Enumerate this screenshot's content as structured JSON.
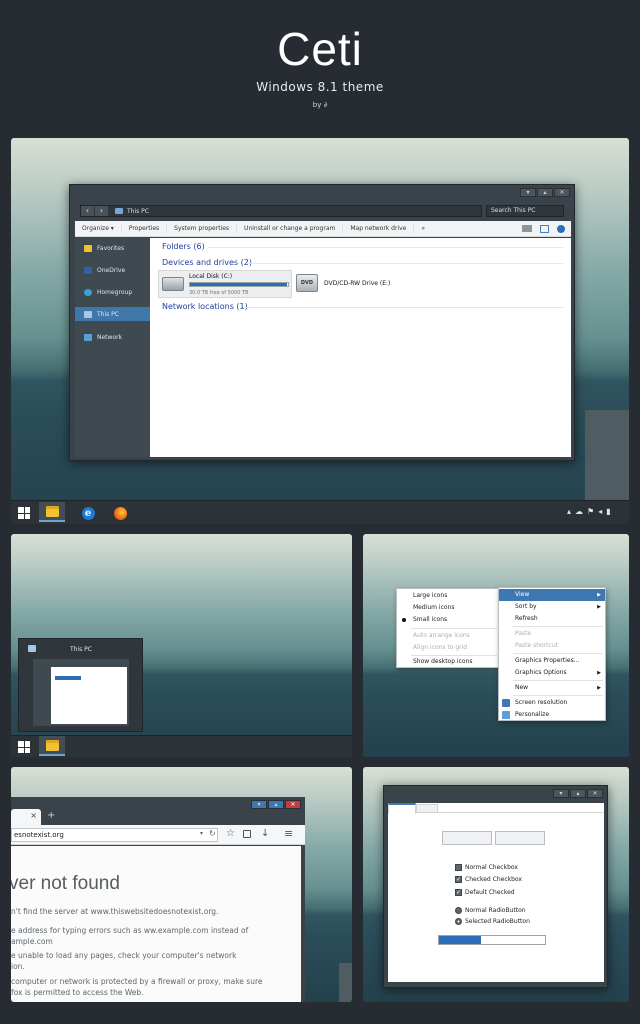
{
  "header": {
    "title": "Ceti",
    "subtitle": "Windows 8.1 theme",
    "byline": "by ∂"
  },
  "explorer": {
    "address": "This PC",
    "search_placeholder": "Search This PC",
    "ribbon": [
      "Organize ▾",
      "Properties",
      "System properties",
      "Uninstall or change a program",
      "Map network drive",
      "»"
    ],
    "nav": [
      "Favorites",
      "OneDrive",
      "Homegroup",
      "This PC",
      "Network"
    ],
    "selected_nav": "This PC",
    "groups": {
      "folders": "Folders (6)",
      "devices": "Devices and drives (2)",
      "network": "Network locations (1)"
    },
    "local_disk": {
      "name": "Local Disk (C:)",
      "free": "30.0 TB free of 5000 TB",
      "used_fraction": 0.994
    },
    "dvd": {
      "name": "DVD/CD-RW Drive (E:)",
      "label": "DVD"
    }
  },
  "thumbnail": {
    "title": "This PC"
  },
  "desktop_menu": {
    "left": [
      {
        "label": "Large icons",
        "state": "normal"
      },
      {
        "label": "Medium icons",
        "state": "normal"
      },
      {
        "label": "Small icons",
        "state": "checked"
      },
      {
        "label": "Auto arrange icons",
        "state": "disabled"
      },
      {
        "label": "Align icons to grid",
        "state": "disabled"
      },
      {
        "label": "Show desktop icons",
        "state": "normal"
      }
    ],
    "right": [
      {
        "label": "View",
        "arrow": true,
        "state": "highlight"
      },
      {
        "label": "Sort by",
        "arrow": true,
        "state": "normal"
      },
      {
        "label": "Refresh",
        "arrow": false,
        "state": "normal"
      },
      {
        "label": "Paste",
        "arrow": false,
        "state": "disabled"
      },
      {
        "label": "Paste shortcut",
        "arrow": false,
        "state": "disabled"
      },
      {
        "label": "Graphics Properties...",
        "arrow": false,
        "state": "normal"
      },
      {
        "label": "Graphics Options",
        "arrow": true,
        "state": "normal"
      },
      {
        "label": "New",
        "arrow": true,
        "state": "normal"
      },
      {
        "label": "Screen resolution",
        "arrow": false,
        "state": "normal",
        "icon": "monitor-icon"
      },
      {
        "label": "Personalize",
        "arrow": false,
        "state": "normal",
        "icon": "personalize-icon"
      }
    ]
  },
  "browser": {
    "url": "esnotexist.org",
    "tab_close": "×",
    "tab_new": "+",
    "heading": "ver not found",
    "lines": [
      "n't find the server at www.thiswebsitedoesnotexist.org.",
      "e address for typing errors such as ww.example.com instead of",
      "ample.com",
      "e unable to load any pages, check your computer's network",
      "ion.",
      "computer or network is protected by a firewall or proxy, make sure",
      "fox is permitted to access the Web."
    ]
  },
  "controls": {
    "checkboxes": [
      "Normal Checkbox",
      "Checked Checkbox",
      "Default Checked"
    ],
    "radios": [
      "Normal RadioButton",
      "Selected RadioButton"
    ],
    "progress_fraction": 0.4
  },
  "colors": {
    "accent": "#3d78b2",
    "window_dark": "#3a434a",
    "close_red": "#c43c3c"
  }
}
